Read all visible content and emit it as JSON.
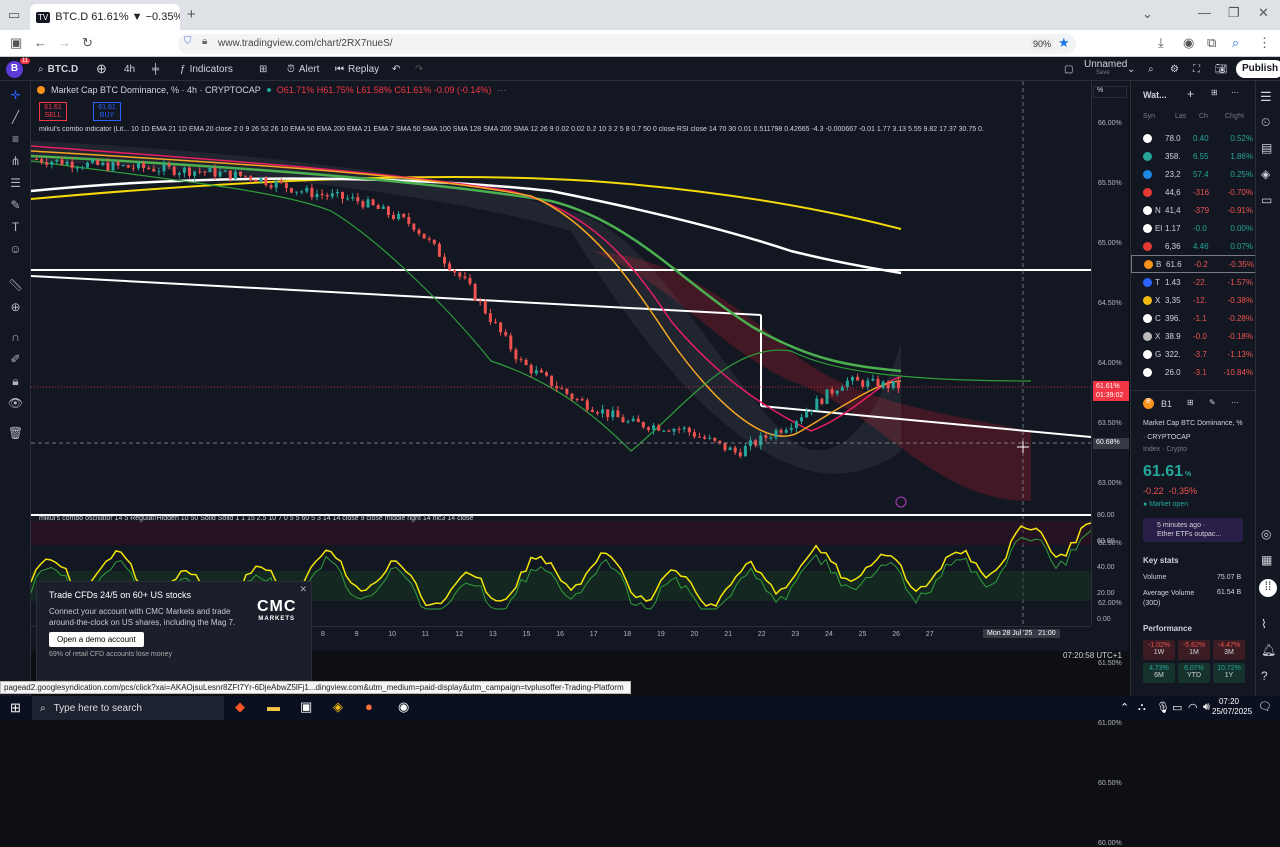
{
  "browser": {
    "tab_title": "BTC.D 61.61% ▼ −0.35% Unna",
    "url": "www.tradingview.com/chart/2RX7nueS/",
    "zoom": "90%"
  },
  "toolbar": {
    "avatar": "B",
    "avatar_badge": "11",
    "symbol": "BTC.D",
    "interval": "4h",
    "indicators": "Indicators",
    "alert": "Alert",
    "replay": "Replay",
    "layout_name": "Unnamed",
    "layout_sub": "Save",
    "publish": "Publish"
  },
  "legend": {
    "title": "Market Cap BTC Dominance, % · 4h · CRYPTOCAP",
    "ohlc": "O61.71% H61.75% L61.58% C61.61% -0.09 (-0.14%)",
    "sell_price": "61.61",
    "sell": "SELL",
    "buy_price": "61.61",
    "buy": "BUY",
    "indicator1": "mikul's combo indicator (Lit... 10 1D EMA 21 1D EMA 20 close 2 0 9 26 52 26 10 EMA 50 EMA 200 EMA 21 EMA 7 SMA 50 SMA 100 SMA 128 SMA 200 SMA 12 26 9 0.02 0.02 0.2 10 3 2 5 8 0.7 50 0 close RSI close 14 70 30 0.01 0.511798 0.42665 -4.3 -0.000667 -0.01 1.77 3.13 5.55 9.82 17.37 30.75 0.",
    "indicator2": "mikul's combo oscillator 14 5 Regular/Hidden 10 50 Solid Solid 1 1 15 2.5 10 7 0 5 5 60 5 3 14 14 close 9 close middle right 14 hlc3 14 close"
  },
  "price_axis": {
    "unit": "%",
    "labels": [
      "66.00%",
      "65.50%",
      "65.00%",
      "64.50%",
      "64.00%",
      "63.50%",
      "63.00%",
      "62.50%",
      "62.00%",
      "61.50%",
      "61.00%",
      "60.50%",
      "60.00%"
    ],
    "current": "61.61%",
    "countdown": "01:39:02",
    "crosshair": "60.68%"
  },
  "osc_axis": {
    "labels": [
      "80.00",
      "60.00",
      "40.00",
      "20.00",
      "0.00"
    ]
  },
  "time_axis": {
    "labels": [
      "8",
      "9",
      "10",
      "11",
      "12",
      "13",
      "15",
      "16",
      "17",
      "18",
      "19",
      "20",
      "21",
      "22",
      "23",
      "24",
      "25",
      "26",
      "27"
    ],
    "crosshair": "Mon 28 Jul '25   21:00",
    "clock": "07:20:58 UTC+1"
  },
  "chart_data": {
    "type": "line",
    "x": [
      "8",
      "9",
      "10",
      "11",
      "12",
      "13",
      "15",
      "16",
      "17",
      "18",
      "19",
      "20",
      "21",
      "22",
      "23",
      "24",
      "25"
    ],
    "series": [
      {
        "values": [
          65.4,
          65.3,
          65.25,
          65.2,
          65.1,
          64.85,
          64.7,
          64.3,
          63.3,
          62.0,
          61.4,
          61.0,
          60.9,
          60.5,
          61.0,
          61.7,
          61.61
        ]
      }
    ],
    "ylabel": "%",
    "ylim": [
      60.0,
      66.0
    ]
  },
  "ad": {
    "title": "Trade CFDs 24/5 on 60+ US stocks",
    "body": "Connect your account with CMC Markets and trade around-the-clock on US shares, including the Mag 7.",
    "button": "Open a demo account",
    "brand": "CMC",
    "brand_sub": "MARKETS",
    "disclaimer": "69% of retail CFD accounts lose money"
  },
  "status_url": "pagead2.googlesyndication.com/pcs/click?xai=AKAOjsuLesnr8ZFt7Yr-6DjeAbwZ5lFj1...dingview.com&utm_medium=paid-display&utm_campaign=tvplusoffer-Trading-Platform",
  "watchlist": {
    "title": "Wat...",
    "cols": [
      "Syn",
      "Las",
      "Ch",
      "Chg%"
    ],
    "rows": [
      {
        "sym": "",
        "last": "78.0",
        "chg": "0.40",
        "pct": "0.52%",
        "color": "#26a69a"
      },
      {
        "sym": "",
        "last": "358.",
        "chg": "6.55",
        "pct": "1.86%",
        "color": "#26a69a"
      },
      {
        "sym": "",
        "last": "23,2",
        "chg": "57.4",
        "pct": "0.25%",
        "color": "#26a69a"
      },
      {
        "sym": "",
        "last": "44,6",
        "chg": "-316",
        "pct": "-0.70%",
        "color": "#ef5350"
      },
      {
        "sym": "N",
        "last": "41,4",
        "chg": "-379",
        "pct": "-0.91%",
        "color": "#ef5350"
      },
      {
        "sym": "El",
        "last": "1.17",
        "chg": "-0.0",
        "pct": "0.00%",
        "color": "#26a69a"
      },
      {
        "sym": "",
        "last": "6,36",
        "chg": "4.46",
        "pct": "0.07%",
        "color": "#26a69a"
      },
      {
        "sym": "B",
        "last": "61.6",
        "chg": "-0.2",
        "pct": "-0.35%",
        "color": "#ef5350"
      },
      {
        "sym": "T",
        "last": "1.43",
        "chg": "-22.",
        "pct": "-1.57%",
        "color": "#ef5350"
      },
      {
        "sym": "X",
        "last": "3,35",
        "chg": "-12.",
        "pct": "-0.38%",
        "color": "#ef5350"
      },
      {
        "sym": "C",
        "last": "396.",
        "chg": "-1.1",
        "pct": "-0.28%",
        "color": "#ef5350"
      },
      {
        "sym": "X",
        "last": "38.9",
        "chg": "-0.0",
        "pct": "-0.18%",
        "color": "#ef5350"
      },
      {
        "sym": "G",
        "last": "322.",
        "chg": "-3.7",
        "pct": "-1.13%",
        "color": "#ef5350"
      },
      {
        "sym": "",
        "last": "26.0",
        "chg": "-3.1",
        "pct": "-10.84%",
        "color": "#ef5350"
      }
    ]
  },
  "detail": {
    "sym": "B1",
    "name": "Market Cap BTC Dominance, %",
    "exchange": "CRYPTOCAP",
    "type": "Index · Crypto",
    "price": "61.61",
    "unit": "%",
    "change": "-0.22  -0.35%",
    "status": "Market open",
    "news_time": "5 minutes ago ·",
    "news": "Ether ETFs outpac...",
    "key_stats": "Key stats",
    "volume_label": "Volume",
    "volume": "75.07 B",
    "avg_volume_label": "Average Volume (30D)",
    "avg_volume": "61.54 B",
    "performance": "Performance",
    "perf": [
      {
        "v": "-1.02%",
        "p": "1W",
        "c": "#ef5350"
      },
      {
        "v": "-5.62%",
        "p": "1M",
        "c": "#ef5350"
      },
      {
        "v": "-4.47%",
        "p": "3M",
        "c": "#ef5350"
      },
      {
        "v": "4.73%",
        "p": "6M",
        "c": "#26a69a"
      },
      {
        "v": "6.07%",
        "p": "YTD",
        "c": "#26a69a"
      },
      {
        "v": "10.72%",
        "p": "1Y",
        "c": "#26a69a"
      }
    ]
  },
  "taskbar": {
    "search": "Type here to search",
    "time": "07:20",
    "date": "25/07/2025"
  }
}
